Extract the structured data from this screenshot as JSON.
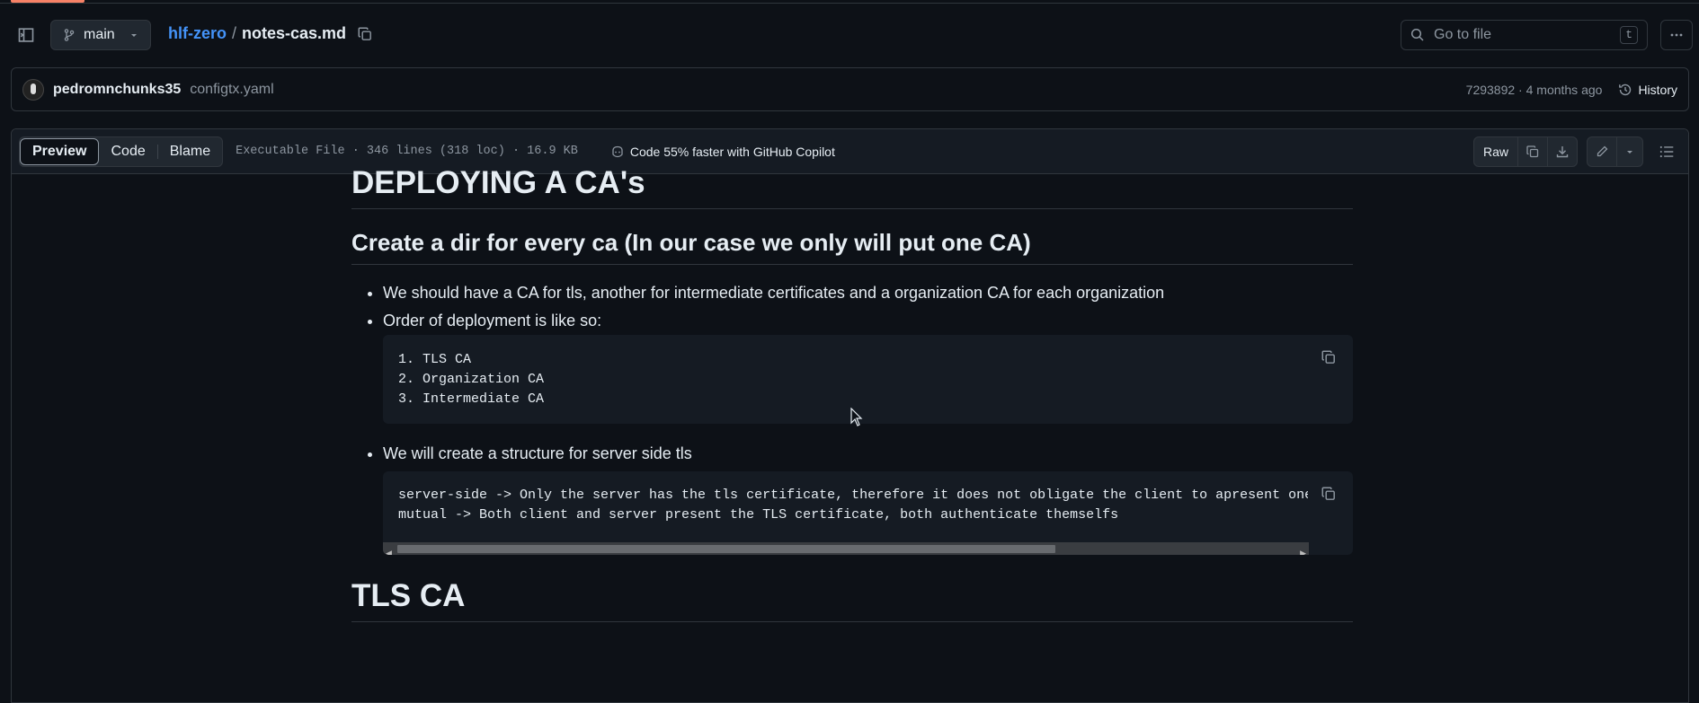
{
  "header": {
    "branch": "main",
    "repo": "hlf-zero",
    "separator": "/",
    "file": "notes-cas.md",
    "search_placeholder": "Go to file",
    "search_shortcut": "t"
  },
  "commit": {
    "author": "pedromnchunks35",
    "message": "configtx.yaml",
    "meta": "7293892 · 4 months ago",
    "history_label": "History"
  },
  "file_toolbar": {
    "tabs": [
      "Preview",
      "Code",
      "Blame"
    ],
    "info": "Executable File · 346 lines (318 loc) · 16.9 KB",
    "copilot": "Code 55% faster with GitHub Copilot",
    "raw_label": "Raw"
  },
  "content": {
    "h1": "DEPLOYING A CA's",
    "h2": "Create a dir for every ca (In our case we only will put one CA)",
    "bullet1": "We should have a CA for tls, another for intermediate certificates and a organization CA for each organization",
    "bullet2": "Order of deployment is like so:",
    "code1": [
      "1. TLS CA",
      "2. Organization CA",
      "3. Intermediate CA"
    ],
    "bullet3": "We will create a structure for server side tls",
    "code2": [
      "server-side -> Only the server has the tls certificate, therefore it does not obligate the client to apresent one",
      "mutual -> Both client and server present the TLS certificate, both authenticate themselfs"
    ],
    "h1b": "TLS CA"
  },
  "colors": {
    "accent": "#f78166",
    "link": "#4493f8",
    "bg": "#0d1117"
  }
}
